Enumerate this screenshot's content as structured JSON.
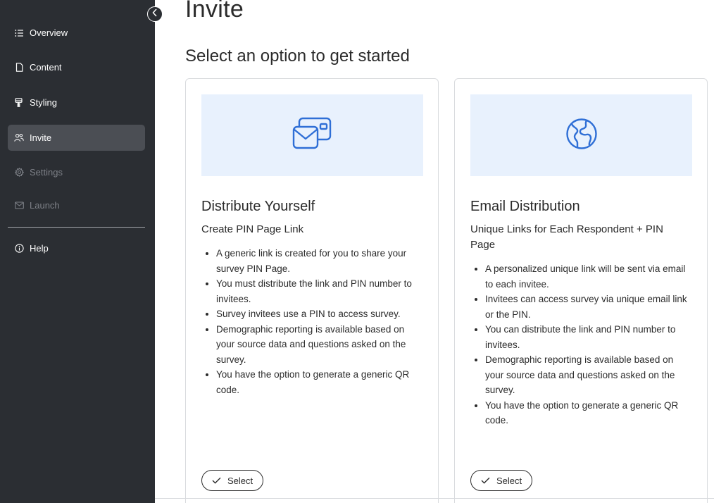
{
  "sidebar": {
    "items": [
      {
        "label": "Overview",
        "icon": "list-icon"
      },
      {
        "label": "Content",
        "icon": "page-icon"
      },
      {
        "label": "Styling",
        "icon": "brush-icon"
      },
      {
        "label": "Invite",
        "icon": "people-icon"
      },
      {
        "label": "Settings",
        "icon": "gear-icon"
      },
      {
        "label": "Launch",
        "icon": "mail-icon"
      },
      {
        "label": "Help",
        "icon": "info-icon"
      }
    ],
    "active": "Invite",
    "disabled": [
      "Settings",
      "Launch"
    ]
  },
  "main": {
    "title": "Invite",
    "subtitle": "Select an option to get started",
    "cards": [
      {
        "icon": "envelope-cards-icon",
        "title": "Distribute Yourself",
        "subtitle": "Create PIN Page Link",
        "bullets": [
          "A generic link is created for you to share your survey PIN Page.",
          "You must distribute the link and PIN number to invitees.",
          "Survey invitees use a PIN to access survey.",
          "Demographic reporting is available based on your source data and questions asked on the survey.",
          "You have the option to generate a generic QR code."
        ],
        "button": "Select"
      },
      {
        "icon": "globe-icon",
        "title": "Email Distribution",
        "subtitle": "Unique Links for Each Respondent + PIN Page",
        "bullets": [
          "A personalized unique link will be sent via email to each invitee.",
          "Invitees can access survey via unique email link or the PIN.",
          "You can distribute the link and PIN number to invitees.",
          "Demographic reporting is available based on your source data and questions asked on the survey.",
          "You have the option to generate a generic QR code."
        ],
        "button": "Select"
      }
    ]
  },
  "colors": {
    "sidebar_bg": "#2b2e33",
    "sidebar_active": "#4b4e54",
    "hero_bg": "#e8f1fd",
    "accent_blue": "#2f6fd6"
  }
}
